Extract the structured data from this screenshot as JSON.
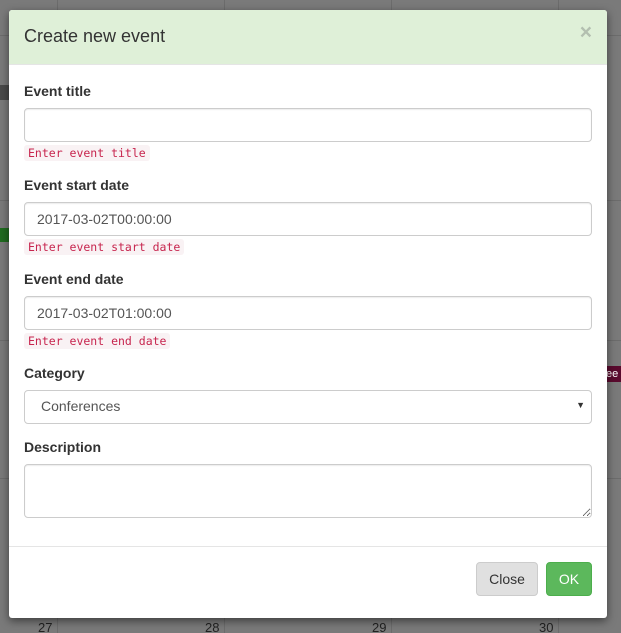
{
  "background": {
    "event_tag_text": "ee",
    "date_numbers": [
      "27",
      "28",
      "29",
      "30"
    ]
  },
  "modal": {
    "title": "Create new event",
    "close_symbol": "×",
    "fields": {
      "title": {
        "label": "Event title",
        "value": "",
        "hint": "Enter event title"
      },
      "start": {
        "label": "Event start date",
        "value": "2017-03-02T00:00:00",
        "hint": "Enter event start date"
      },
      "end": {
        "label": "Event end date",
        "value": "2017-03-02T01:00:00",
        "hint": "Enter event end date"
      },
      "category": {
        "label": "Category",
        "selected": "Conferences",
        "caret": "▼"
      },
      "description": {
        "label": "Description",
        "value": ""
      }
    },
    "footer": {
      "close_label": "Close",
      "ok_label": "OK"
    }
  },
  "colors": {
    "header_bg": "#dff0d8",
    "ok_button": "#5cb85c",
    "hint_text": "#c7254e"
  }
}
